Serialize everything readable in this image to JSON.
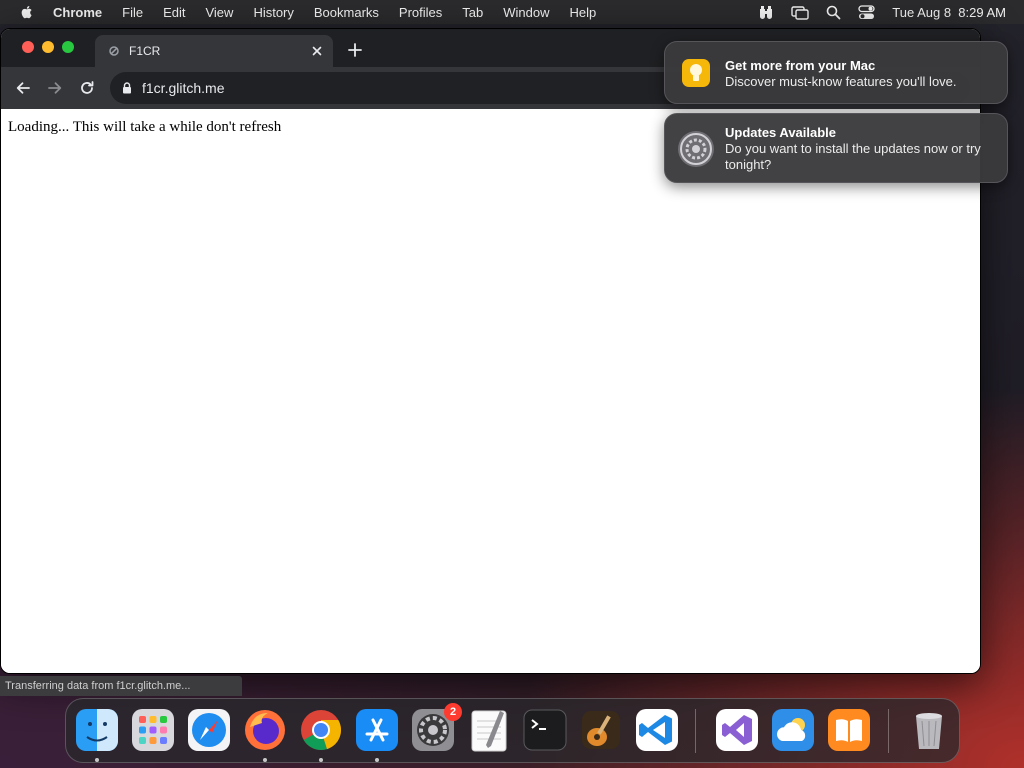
{
  "menubar": {
    "app_name": "Chrome",
    "items": [
      "File",
      "Edit",
      "View",
      "History",
      "Bookmarks",
      "Profiles",
      "Tab",
      "Window",
      "Help"
    ],
    "clock": "Tue Aug 8  8:29 AM"
  },
  "browser": {
    "tab_title": "F1CR",
    "url": "f1cr.glitch.me",
    "page_text": "Loading... This will take a while don't refresh",
    "status": "Transferring data from f1cr.glitch.me..."
  },
  "notifications": [
    {
      "title": "Get more from your Mac",
      "body": "Discover must-know features you'll love."
    },
    {
      "title": "Updates Available",
      "body": "Do you want to install the updates now or try tonight?"
    }
  ],
  "dock": {
    "settings_badge": "2"
  },
  "colors": {
    "close": "#ff5f57",
    "minimize": "#febc2e",
    "maximize": "#28c840",
    "badge": "#ff3b30"
  }
}
